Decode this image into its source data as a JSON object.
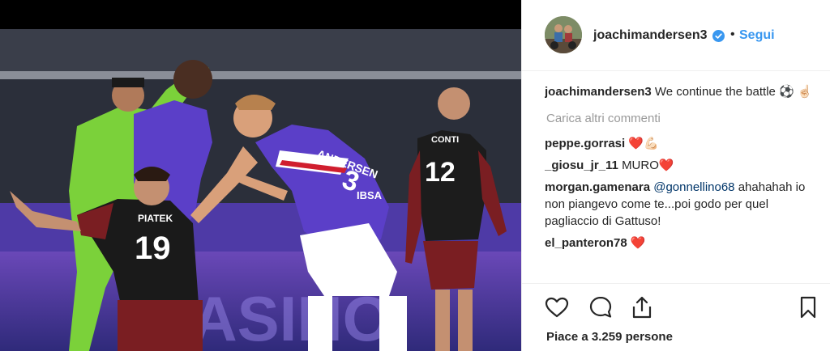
{
  "post": {
    "username": "joachimandersen3",
    "separator": "•",
    "follow_label": "Segui"
  },
  "caption": {
    "username": "joachimandersen3",
    "text": "We continue the battle ⚽ ☝🏻"
  },
  "load_more_label": "Carica altri commenti",
  "comments": [
    {
      "username": "peppe.gorrasi",
      "text": "❤️💪🏻"
    },
    {
      "username": "_giosu_jr_11",
      "text": "MURO❤️"
    },
    {
      "username": "morgan.gamenara",
      "mention": "@gonnellino68",
      "text": "ahahahah io non piangevo come te...poi godo per quel pagliaccio di Gattuso!"
    },
    {
      "username": "el_panteron78",
      "text": "❤️"
    }
  ],
  "likes_text": "Piace a 3.259 persone",
  "photo": {
    "jersey_19_name": "PIATEK",
    "jersey_19_number": "19",
    "jersey_12_name": "CONTI",
    "jersey_12_number": "12",
    "jersey_3_name": "ANDERSEN",
    "jersey_3_number": "3",
    "sponsor": "IBSA",
    "board_text": "CASINÒ"
  },
  "icons": {
    "verified": "verified-badge-icon",
    "like": "heart-icon",
    "comment": "comment-bubble-icon",
    "share": "share-icon",
    "save": "bookmark-icon"
  },
  "colors": {
    "follow": "#3897f0",
    "verified": "#3897f0",
    "sampdoria_blue": "#5b3fc8",
    "milan_red": "#7a1e22",
    "keeper_green": "#7bd13a"
  }
}
